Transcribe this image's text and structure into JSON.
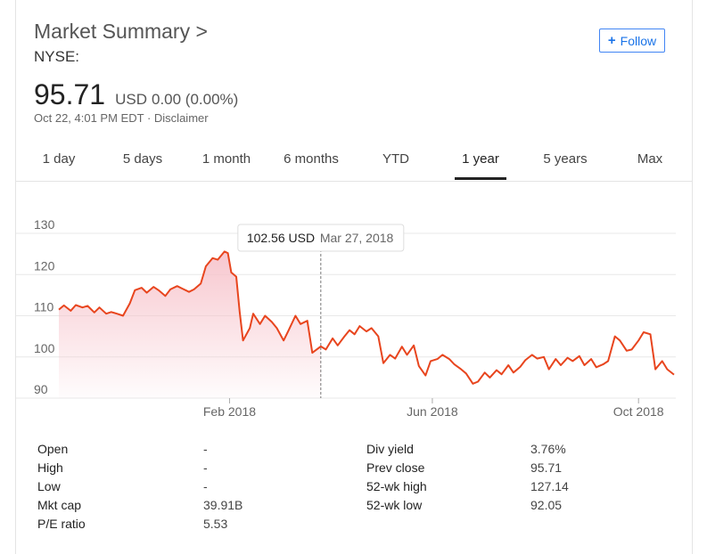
{
  "header": {
    "title": "Market Summary >",
    "exchange": "NYSE:",
    "follow_label": "Follow"
  },
  "quote": {
    "price": "95.71",
    "currency": "USD",
    "change": "0.00 (0.00%)",
    "timestamp": "Oct 22, 4:01 PM EDT",
    "separator": "·",
    "disclaimer": "Disclaimer"
  },
  "tabs": [
    {
      "label": "1 day"
    },
    {
      "label": "5 days"
    },
    {
      "label": "1 month"
    },
    {
      "label": "6 months"
    },
    {
      "label": "YTD"
    },
    {
      "label": "1 year"
    },
    {
      "label": "5 years"
    },
    {
      "label": "Max"
    }
  ],
  "active_tab": "1 year",
  "tooltip": {
    "value": "102.56 USD",
    "date": "Mar 27, 2018"
  },
  "chart_data": {
    "type": "area",
    "title": "",
    "xlabel": "",
    "ylabel": "",
    "ylim": [
      90,
      130
    ],
    "yticks": [
      "90",
      "100",
      "110",
      "120",
      "130"
    ],
    "xticks": [
      {
        "label": "Feb 2018",
        "x": "2018-02-01"
      },
      {
        "label": "Jun 2018",
        "x": "2018-06-01"
      },
      {
        "label": "Oct 2018",
        "x": "2018-10-01"
      }
    ],
    "x_start": "2017-10-23",
    "x_end": "2018-10-22",
    "line_color": "#e8451e",
    "fill_color": "#f7c4cc",
    "grid": true,
    "highlight": {
      "x": "2018-03-27",
      "y": 102.56
    },
    "series": [
      {
        "values": [
          {
            "x": "2017-10-23",
            "y": 111.5
          },
          {
            "x": "2017-10-26",
            "y": 112.5
          },
          {
            "x": "2017-10-30",
            "y": 111.2
          },
          {
            "x": "2017-11-02",
            "y": 112.6
          },
          {
            "x": "2017-11-06",
            "y": 112.0
          },
          {
            "x": "2017-11-09",
            "y": 112.4
          },
          {
            "x": "2017-11-13",
            "y": 110.8
          },
          {
            "x": "2017-11-16",
            "y": 112.0
          },
          {
            "x": "2017-11-20",
            "y": 110.5
          },
          {
            "x": "2017-11-23",
            "y": 110.9
          },
          {
            "x": "2017-11-27",
            "y": 110.4
          },
          {
            "x": "2017-11-30",
            "y": 110.0
          },
          {
            "x": "2017-12-04",
            "y": 113.0
          },
          {
            "x": "2017-12-07",
            "y": 116.2
          },
          {
            "x": "2017-12-11",
            "y": 116.8
          },
          {
            "x": "2017-12-14",
            "y": 115.6
          },
          {
            "x": "2017-12-18",
            "y": 117.0
          },
          {
            "x": "2017-12-21",
            "y": 116.2
          },
          {
            "x": "2017-12-25",
            "y": 114.8
          },
          {
            "x": "2017-12-28",
            "y": 116.4
          },
          {
            "x": "2018-01-01",
            "y": 117.2
          },
          {
            "x": "2018-01-04",
            "y": 116.6
          },
          {
            "x": "2018-01-08",
            "y": 115.8
          },
          {
            "x": "2018-01-11",
            "y": 116.4
          },
          {
            "x": "2018-01-15",
            "y": 117.8
          },
          {
            "x": "2018-01-18",
            "y": 122.0
          },
          {
            "x": "2018-01-22",
            "y": 124.0
          },
          {
            "x": "2018-01-25",
            "y": 123.6
          },
          {
            "x": "2018-01-29",
            "y": 125.6
          },
          {
            "x": "2018-01-31",
            "y": 125.2
          },
          {
            "x": "2018-02-02",
            "y": 120.5
          },
          {
            "x": "2018-02-05",
            "y": 119.5
          },
          {
            "x": "2018-02-07",
            "y": 111.0
          },
          {
            "x": "2018-02-09",
            "y": 104.0
          },
          {
            "x": "2018-02-13",
            "y": 107.0
          },
          {
            "x": "2018-02-15",
            "y": 110.5
          },
          {
            "x": "2018-02-19",
            "y": 108.0
          },
          {
            "x": "2018-02-22",
            "y": 110.0
          },
          {
            "x": "2018-02-26",
            "y": 108.5
          },
          {
            "x": "2018-03-01",
            "y": 107.0
          },
          {
            "x": "2018-03-05",
            "y": 104.0
          },
          {
            "x": "2018-03-08",
            "y": 106.5
          },
          {
            "x": "2018-03-12",
            "y": 110.0
          },
          {
            "x": "2018-03-15",
            "y": 108.0
          },
          {
            "x": "2018-03-19",
            "y": 108.8
          },
          {
            "x": "2018-03-22",
            "y": 101.0
          },
          {
            "x": "2018-03-27",
            "y": 102.56
          },
          {
            "x": "2018-03-30",
            "y": 101.8
          },
          {
            "x": "2018-04-03",
            "y": 104.5
          },
          {
            "x": "2018-04-06",
            "y": 102.8
          },
          {
            "x": "2018-04-10",
            "y": 105.0
          },
          {
            "x": "2018-04-13",
            "y": 106.5
          },
          {
            "x": "2018-04-16",
            "y": 105.5
          },
          {
            "x": "2018-04-19",
            "y": 107.5
          },
          {
            "x": "2018-04-23",
            "y": 106.2
          },
          {
            "x": "2018-04-26",
            "y": 107.0
          },
          {
            "x": "2018-04-30",
            "y": 105.0
          },
          {
            "x": "2018-05-03",
            "y": 98.5
          },
          {
            "x": "2018-05-07",
            "y": 100.5
          },
          {
            "x": "2018-05-10",
            "y": 99.6
          },
          {
            "x": "2018-05-14",
            "y": 102.5
          },
          {
            "x": "2018-05-17",
            "y": 100.5
          },
          {
            "x": "2018-05-21",
            "y": 102.8
          },
          {
            "x": "2018-05-24",
            "y": 97.8
          },
          {
            "x": "2018-05-28",
            "y": 95.5
          },
          {
            "x": "2018-05-31",
            "y": 99.0
          },
          {
            "x": "2018-06-04",
            "y": 99.5
          },
          {
            "x": "2018-06-07",
            "y": 100.5
          },
          {
            "x": "2018-06-11",
            "y": 99.5
          },
          {
            "x": "2018-06-14",
            "y": 98.2
          },
          {
            "x": "2018-06-18",
            "y": 97.0
          },
          {
            "x": "2018-06-21",
            "y": 96.0
          },
          {
            "x": "2018-06-25",
            "y": 93.5
          },
          {
            "x": "2018-06-28",
            "y": 94.0
          },
          {
            "x": "2018-07-02",
            "y": 96.2
          },
          {
            "x": "2018-07-05",
            "y": 95.0
          },
          {
            "x": "2018-07-09",
            "y": 96.8
          },
          {
            "x": "2018-07-12",
            "y": 95.8
          },
          {
            "x": "2018-07-16",
            "y": 98.0
          },
          {
            "x": "2018-07-19",
            "y": 96.2
          },
          {
            "x": "2018-07-23",
            "y": 97.6
          },
          {
            "x": "2018-07-26",
            "y": 99.2
          },
          {
            "x": "2018-07-30",
            "y": 100.5
          },
          {
            "x": "2018-08-02",
            "y": 99.6
          },
          {
            "x": "2018-08-06",
            "y": 100.0
          },
          {
            "x": "2018-08-09",
            "y": 97.0
          },
          {
            "x": "2018-08-13",
            "y": 99.5
          },
          {
            "x": "2018-08-16",
            "y": 98.0
          },
          {
            "x": "2018-08-20",
            "y": 99.8
          },
          {
            "x": "2018-08-23",
            "y": 99.0
          },
          {
            "x": "2018-08-27",
            "y": 100.2
          },
          {
            "x": "2018-08-30",
            "y": 98.0
          },
          {
            "x": "2018-09-03",
            "y": 99.5
          },
          {
            "x": "2018-09-06",
            "y": 97.5
          },
          {
            "x": "2018-09-10",
            "y": 98.2
          },
          {
            "x": "2018-09-13",
            "y": 99.0
          },
          {
            "x": "2018-09-17",
            "y": 105.0
          },
          {
            "x": "2018-09-20",
            "y": 104.0
          },
          {
            "x": "2018-09-24",
            "y": 101.5
          },
          {
            "x": "2018-09-27",
            "y": 101.8
          },
          {
            "x": "2018-10-01",
            "y": 104.0
          },
          {
            "x": "2018-10-04",
            "y": 106.0
          },
          {
            "x": "2018-10-08",
            "y": 105.5
          },
          {
            "x": "2018-10-11",
            "y": 97.0
          },
          {
            "x": "2018-10-15",
            "y": 99.0
          },
          {
            "x": "2018-10-18",
            "y": 97.0
          },
          {
            "x": "2018-10-22",
            "y": 95.71
          }
        ]
      }
    ]
  },
  "stats": {
    "left": [
      {
        "label": "Open",
        "value": "-"
      },
      {
        "label": "High",
        "value": "-"
      },
      {
        "label": "Low",
        "value": "-"
      },
      {
        "label": "Mkt cap",
        "value": "39.91B"
      },
      {
        "label": "P/E ratio",
        "value": "5.53"
      }
    ],
    "right": [
      {
        "label": "Div yield",
        "value": "3.76%"
      },
      {
        "label": "Prev close",
        "value": "95.71"
      },
      {
        "label": "52-wk high",
        "value": "127.14"
      },
      {
        "label": "52-wk low",
        "value": "92.05"
      }
    ]
  }
}
